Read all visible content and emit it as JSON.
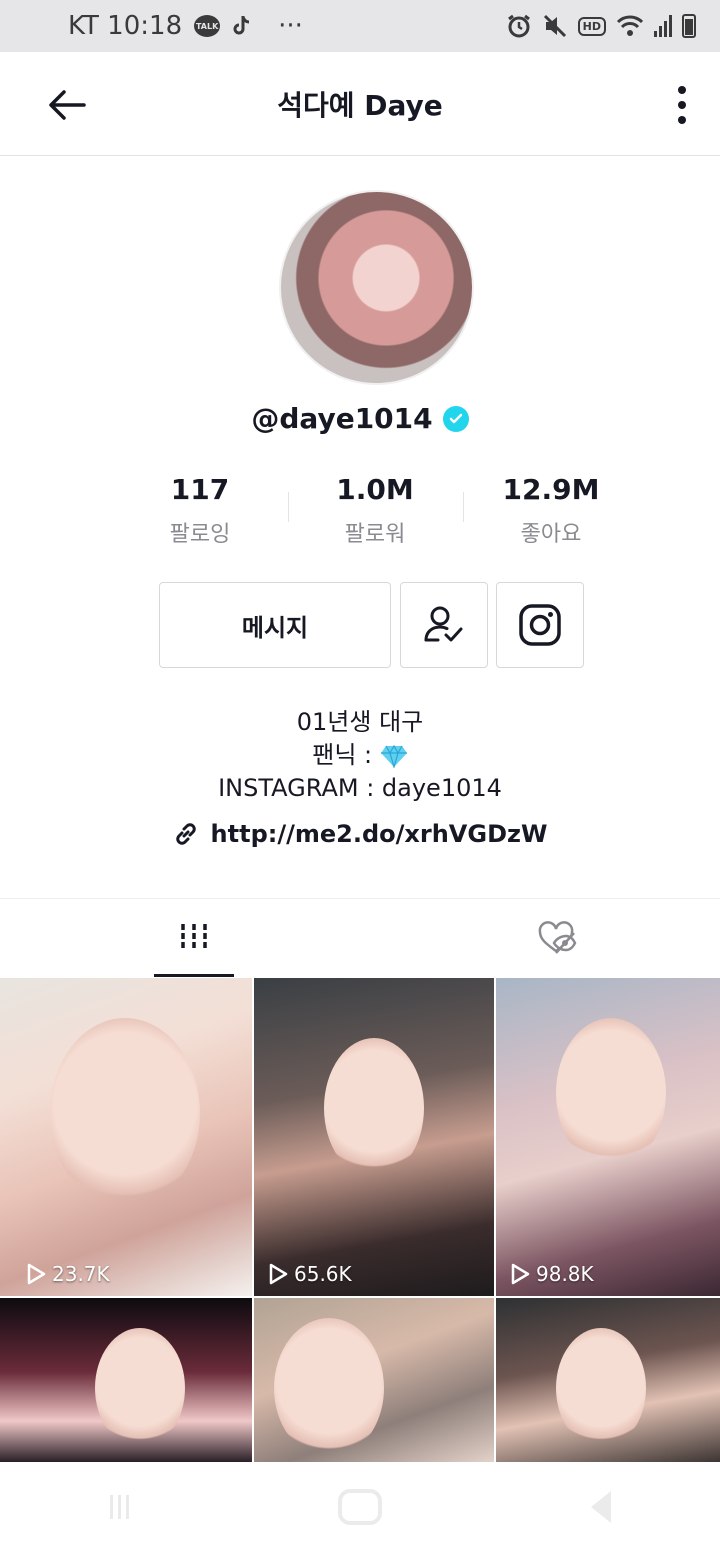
{
  "status_bar": {
    "carrier_time": "KT 10:18",
    "talk_icon_text": "TALK",
    "more_glyph": "···",
    "hd_label": "HD"
  },
  "header": {
    "title": "석다예 Daye"
  },
  "profile": {
    "username": "@daye1014",
    "verified": true,
    "stats": [
      {
        "value": "117",
        "label": "팔로잉"
      },
      {
        "value": "1.0M",
        "label": "팔로워"
      },
      {
        "value": "12.9M",
        "label": "좋아요"
      }
    ],
    "message_button": "메시지",
    "bio": {
      "line1": "01년생 대구",
      "line2_text": "팬닉 :",
      "line3": "INSTAGRAM : daye1014"
    },
    "link": "http://me2.do/xrhVGDzW"
  },
  "tabs": [
    {
      "name": "videos",
      "active": true
    },
    {
      "name": "liked-private",
      "active": false
    }
  ],
  "videos": [
    {
      "views": "23.7K"
    },
    {
      "views": "65.6K"
    },
    {
      "views": "98.8K"
    },
    {
      "views": ""
    },
    {
      "views": ""
    },
    {
      "views": ""
    }
  ],
  "colors": {
    "text_primary": "#161823",
    "text_secondary": "#8a8b91",
    "verified": "#20d5ec",
    "border": "#d8d8da"
  }
}
